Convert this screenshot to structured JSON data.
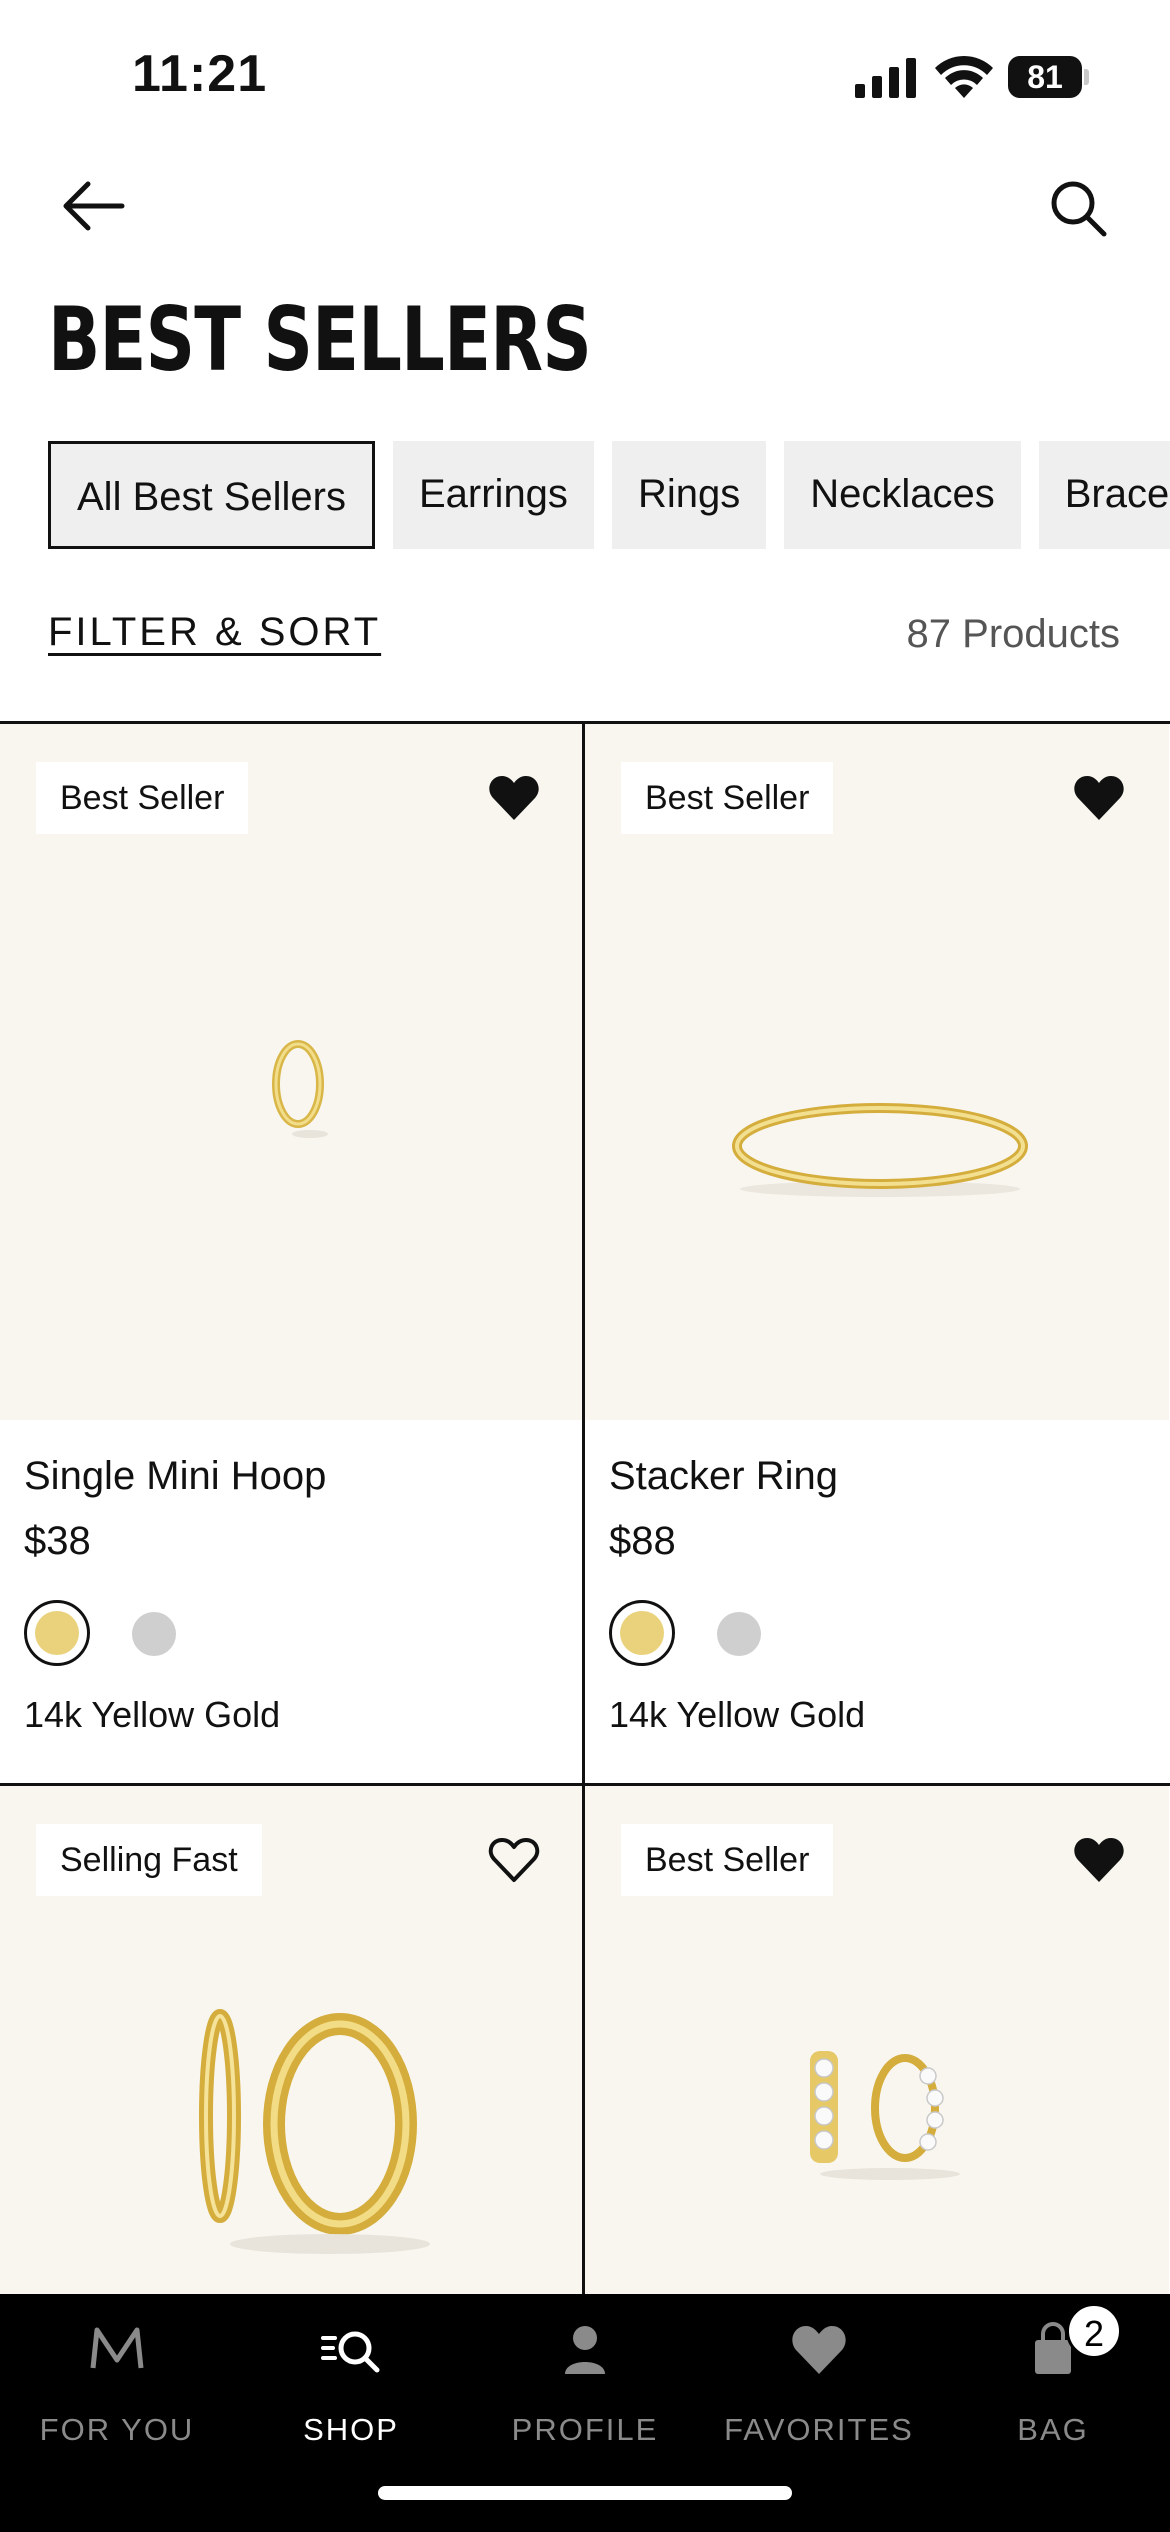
{
  "status_bar": {
    "time": "11:21",
    "battery": "81"
  },
  "header": {
    "title": "BEST SELLERS"
  },
  "categories": [
    {
      "label": "All Best Sellers",
      "active": true
    },
    {
      "label": "Earrings",
      "active": false
    },
    {
      "label": "Rings",
      "active": false
    },
    {
      "label": "Necklaces",
      "active": false
    },
    {
      "label": "Bracelets",
      "active": false
    }
  ],
  "toolbar": {
    "filter_sort": "FILTER & SORT",
    "count": "87 Products"
  },
  "products": [
    {
      "badge": "Best Seller",
      "favorited": true,
      "name": "Single Mini Hoop",
      "price": "$38",
      "metal": "14k Yellow Gold",
      "image": "mini-hoop-earring"
    },
    {
      "badge": "Best Seller",
      "favorited": true,
      "name": "Stacker Ring",
      "price": "$88",
      "metal": "14k Yellow Gold",
      "image": "stacker-ring"
    },
    {
      "badge": "Selling Fast",
      "favorited": false,
      "name": "",
      "price": "",
      "metal": "",
      "image": "gold-hoop-earrings"
    },
    {
      "badge": "Best Seller",
      "favorited": true,
      "name": "",
      "price": "",
      "metal": "",
      "image": "crystal-huggie-earrings"
    }
  ],
  "colors": {
    "image_bg": "#f8f6ef",
    "gold_swatch": "#ead27c",
    "silver_swatch": "#cfcfcf"
  },
  "tab_bar": {
    "tabs": [
      {
        "label": "FOR YOU",
        "icon": "m-logo-icon",
        "active": false
      },
      {
        "label": "SHOP",
        "icon": "shop-search-icon",
        "active": true
      },
      {
        "label": "PROFILE",
        "icon": "profile-icon",
        "active": false
      },
      {
        "label": "FAVORITES",
        "icon": "heart-icon",
        "active": false
      },
      {
        "label": "BAG",
        "icon": "bag-icon",
        "active": false
      }
    ],
    "bag_count": "2"
  }
}
